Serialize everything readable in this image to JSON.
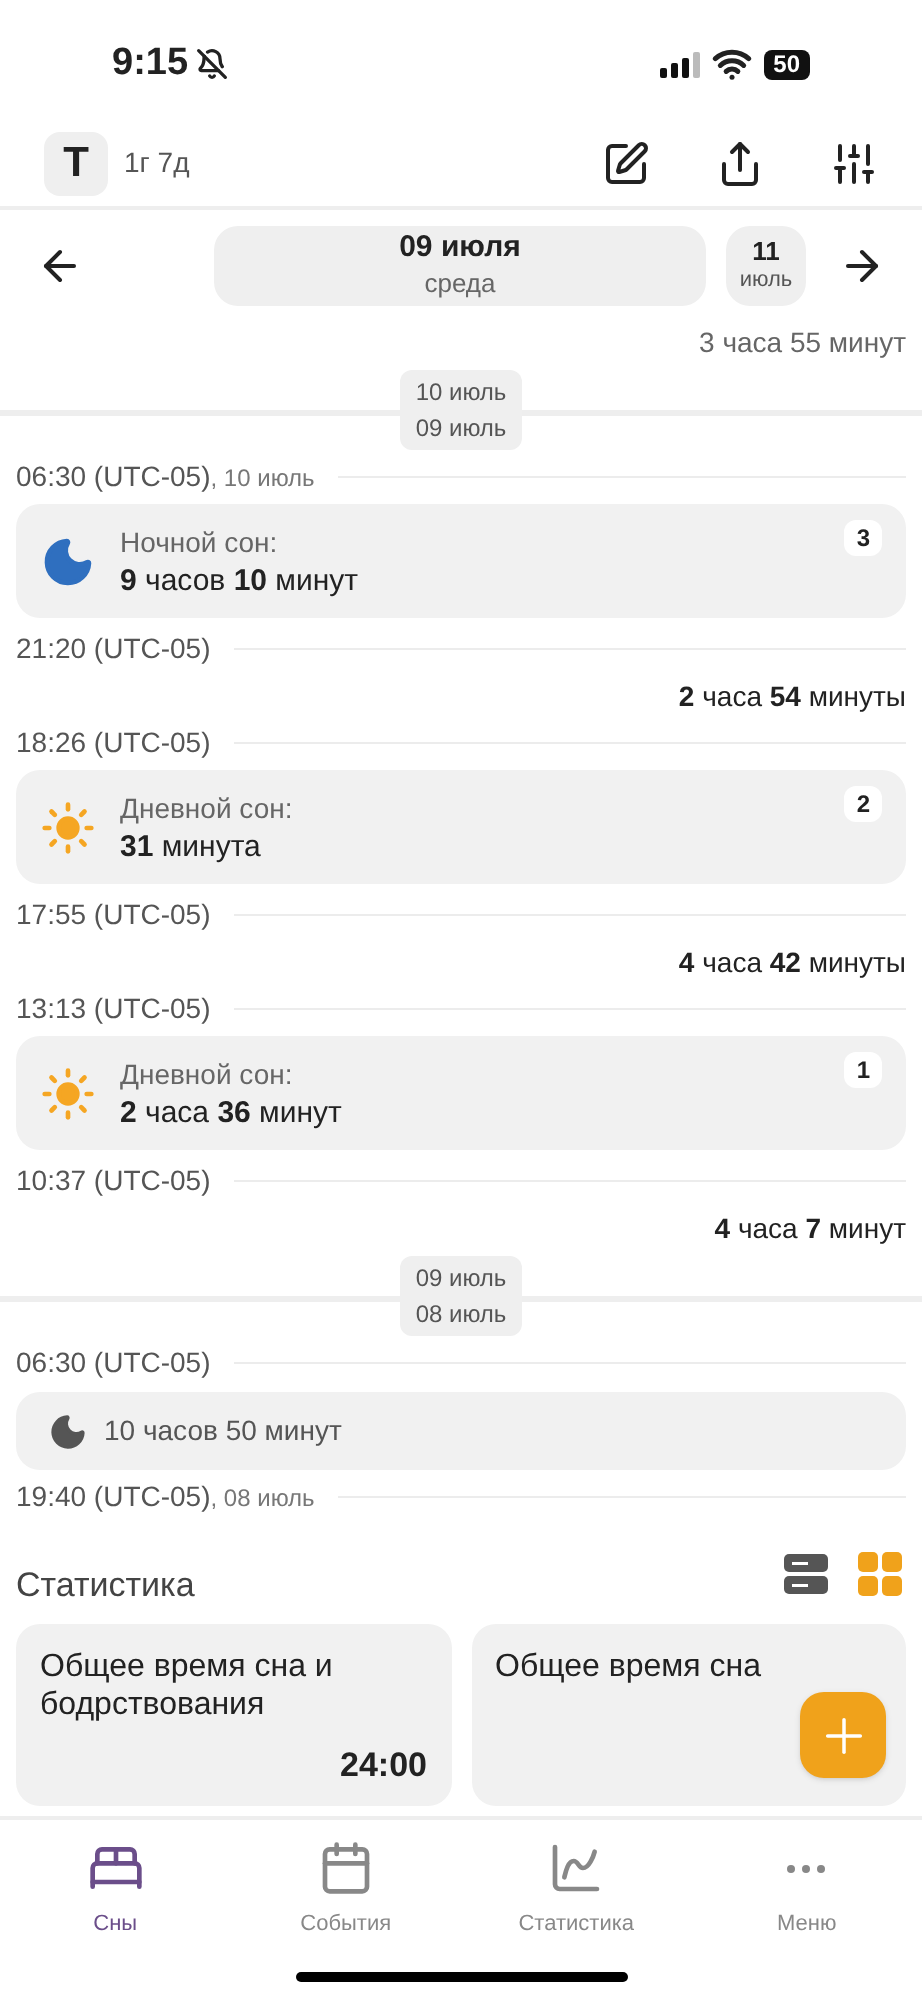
{
  "status_bar": {
    "time": "9:15",
    "battery": "50"
  },
  "header": {
    "avatar": "T",
    "age": "1г 7д"
  },
  "date_nav": {
    "current": {
      "date": "09 июля",
      "weekday": "среда"
    },
    "next": {
      "day": "11",
      "month": "июль"
    }
  },
  "timeline": [
    {
      "kind": "gap",
      "text": "3 часа 55 минут",
      "muted": true
    },
    {
      "kind": "divider",
      "top": "10 июль",
      "bottom": "09 июль"
    },
    {
      "kind": "time",
      "time": "06:30 (UTC-05)",
      "date": ", 10 июль"
    },
    {
      "kind": "night",
      "label": "Ночной сон:",
      "duration": "**9** часов **10** минут",
      "count": "3"
    },
    {
      "kind": "time",
      "time": "21:20 (UTC-05)"
    },
    {
      "kind": "gap",
      "text": "**2** часа **54** минуты",
      "muted": false
    },
    {
      "kind": "time",
      "time": "18:26 (UTC-05)"
    },
    {
      "kind": "day",
      "label": "Дневной сон:",
      "duration": "**31** минута",
      "count": "2"
    },
    {
      "kind": "time",
      "time": "17:55 (UTC-05)"
    },
    {
      "kind": "gap",
      "text": "**4** часа **42** минуты",
      "muted": false
    },
    {
      "kind": "time",
      "time": "13:13 (UTC-05)"
    },
    {
      "kind": "day",
      "label": "Дневной сон:",
      "duration": "**2** часа **36** минут",
      "count": "1"
    },
    {
      "kind": "time",
      "time": "10:37 (UTC-05)"
    },
    {
      "kind": "gap",
      "text": "**4** часа **7** минут",
      "muted": false
    },
    {
      "kind": "divider",
      "top": "09 июль",
      "bottom": "08 июль"
    },
    {
      "kind": "time",
      "time": "06:30 (UTC-05)"
    },
    {
      "kind": "compact",
      "text": "10 часов 50 минут"
    },
    {
      "kind": "time",
      "time": "19:40 (UTC-05)",
      "date": ", 08 июль"
    }
  ],
  "stats": {
    "title": "Статистика",
    "views": [
      {
        "kind": "list",
        "selected": false
      },
      {
        "kind": "grid",
        "selected": true
      }
    ],
    "cards": [
      {
        "title": "Общее время сна и бодрствования",
        "value": "24:00"
      },
      {
        "title": "Общее время сна"
      }
    ]
  },
  "tabs": [
    {
      "label": "Сны",
      "selected": true
    },
    {
      "label": "События",
      "selected": false
    },
    {
      "label": "Статистика",
      "selected": false
    },
    {
      "label": "Меню",
      "selected": false
    }
  ]
}
